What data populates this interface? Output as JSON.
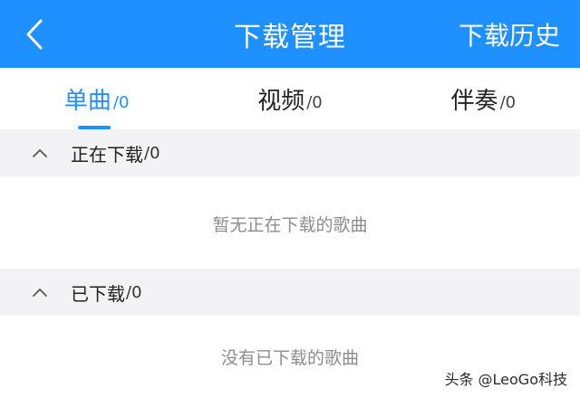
{
  "header": {
    "title": "下载管理",
    "action": "下载历史",
    "background": "#1e90ff"
  },
  "tabs": [
    {
      "label": "单曲",
      "count": "/0",
      "active": true
    },
    {
      "label": "视频",
      "count": "/0",
      "active": false
    },
    {
      "label": "伴奏",
      "count": "/0",
      "active": false
    }
  ],
  "sections": [
    {
      "title": "正在下载",
      "count": "/0",
      "empty_text": "暂无正在下载的歌曲",
      "icon": "chevron-up-icon"
    },
    {
      "title": "已下载",
      "count": "/0",
      "empty_text": "没有已下载的歌曲",
      "icon": "chevron-up-icon"
    }
  ],
  "watermark": "头条 @LeoGo科技",
  "colors": {
    "accent": "#1e90ff",
    "section_bg": "#f3f3f5",
    "muted_text": "#8c8c8c"
  }
}
